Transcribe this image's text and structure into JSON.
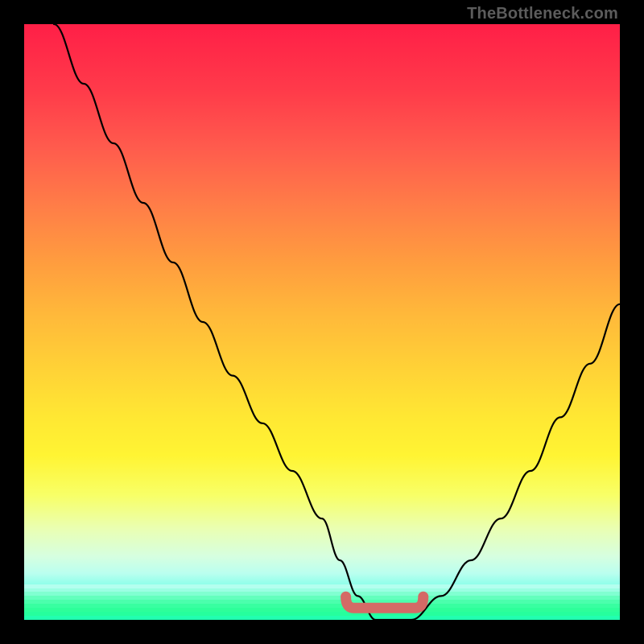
{
  "attribution": "TheBottleneck.com",
  "chart_data": {
    "type": "line",
    "title": "",
    "xlabel": "",
    "ylabel": "",
    "xlim": [
      0,
      100
    ],
    "ylim": [
      0,
      100
    ],
    "x": [
      5,
      10,
      15,
      20,
      25,
      30,
      35,
      40,
      45,
      50,
      53,
      56,
      59,
      62,
      65,
      70,
      75,
      80,
      85,
      90,
      95,
      100
    ],
    "values": [
      100,
      90,
      80,
      70,
      60,
      50,
      41,
      33,
      25,
      17,
      10,
      4,
      0,
      0,
      0,
      4,
      10,
      17,
      25,
      34,
      43,
      53
    ],
    "annotations": [
      {
        "label": "optimal-band",
        "x_start": 54,
        "x_end": 67,
        "y": 2
      }
    ],
    "background_gradient_stops": [
      {
        "pct": 0,
        "color": "#ff1f47"
      },
      {
        "pct": 25,
        "color": "#ff6b48"
      },
      {
        "pct": 50,
        "color": "#ffc238"
      },
      {
        "pct": 75,
        "color": "#fff433"
      },
      {
        "pct": 92,
        "color": "#d6ffe0"
      },
      {
        "pct": 100,
        "color": "#26ff9d"
      }
    ],
    "bottom_bands": [
      "#b4ffef",
      "#9bffe3",
      "#80ffd1",
      "#63ffbd",
      "#4bffad",
      "#38ffa1",
      "#2dff9a",
      "#26ff9d",
      "#22ffb0"
    ]
  }
}
